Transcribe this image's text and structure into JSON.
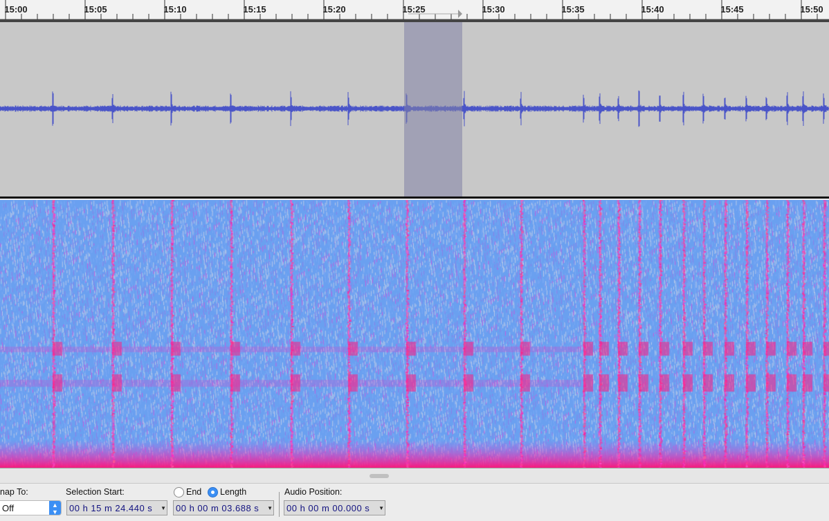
{
  "timeline": {
    "tick_labels": [
      "15:00",
      "15:05",
      "15:10",
      "15:15",
      "15:20",
      "15:25",
      "15:30",
      "15:35",
      "15:40",
      "15:45",
      "15:50"
    ]
  },
  "colors": {
    "waveform": "#4a55c8",
    "selection": "#8a8aaa",
    "spectrogram_base": "#6aa0f0",
    "spectrogram_hot": "#ff2d90",
    "accent": "#3b8ff4"
  },
  "toolbar": {
    "snap_to_label": "nap To:",
    "snap_to_value": "Off",
    "selection_start_label": "Selection Start:",
    "end_label": "End",
    "length_label": "Length",
    "length_selected": true,
    "audio_position_label": "Audio Position:",
    "selection_start_value": "00 h 15 m 24.440 s",
    "selection_length_value": "00 h 00 m 03.688 s",
    "audio_position_value": "00 h 00 m 00.000 s"
  }
}
